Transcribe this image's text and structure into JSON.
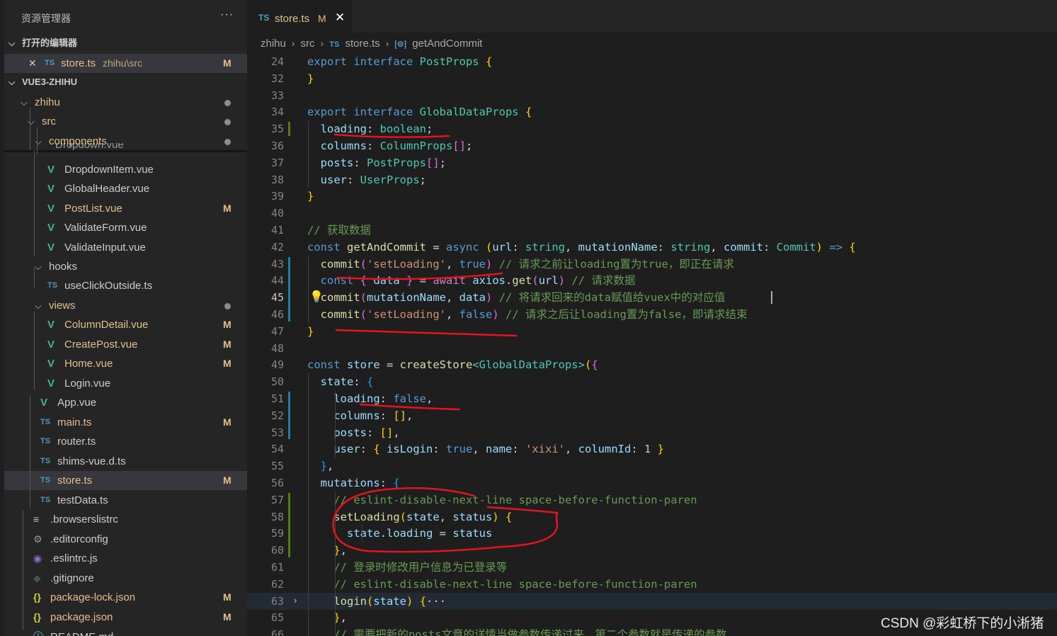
{
  "explorer": {
    "title": "资源管理器",
    "more": "···",
    "open_editors": {
      "label": "打开的编辑器",
      "items": [
        {
          "icon": "TS",
          "name": "store.ts",
          "path": "zhihu\\src",
          "badge": "M"
        }
      ]
    },
    "project": {
      "label": "VUE3-ZHIHU"
    },
    "partial_item": "Dropdown.vue",
    "tree": [
      {
        "name": "zhihu",
        "type": "folder",
        "dot": true
      },
      {
        "name": "src",
        "type": "folder",
        "dot": true
      },
      {
        "name": "components",
        "type": "folder",
        "dot": true
      },
      {
        "name": "DropdownItem.vue",
        "type": "vue",
        "badge": ""
      },
      {
        "name": "GlobalHeader.vue",
        "type": "vue",
        "badge": ""
      },
      {
        "name": "PostList.vue",
        "type": "vue",
        "badge": "M"
      },
      {
        "name": "ValidateForm.vue",
        "type": "vue",
        "badge": ""
      },
      {
        "name": "ValidateInput.vue",
        "type": "vue",
        "badge": ""
      },
      {
        "name": "hooks",
        "type": "folder",
        "dot": false
      },
      {
        "name": "useClickOutside.ts",
        "type": "ts",
        "badge": ""
      },
      {
        "name": "views",
        "type": "folder",
        "dot": true
      },
      {
        "name": "ColumnDetail.vue",
        "type": "vue",
        "badge": "M"
      },
      {
        "name": "CreatePost.vue",
        "type": "vue",
        "badge": "M"
      },
      {
        "name": "Home.vue",
        "type": "vue",
        "badge": "M"
      },
      {
        "name": "Login.vue",
        "type": "vue",
        "badge": ""
      },
      {
        "name": "App.vue",
        "type": "vue",
        "badge": ""
      },
      {
        "name": "main.ts",
        "type": "ts",
        "badge": "M"
      },
      {
        "name": "router.ts",
        "type": "ts",
        "badge": ""
      },
      {
        "name": "shims-vue.d.ts",
        "type": "ts",
        "badge": ""
      },
      {
        "name": "store.ts",
        "type": "ts",
        "badge": "M"
      },
      {
        "name": "testData.ts",
        "type": "ts",
        "badge": ""
      },
      {
        "name": ".browserslistrc",
        "type": "lines",
        "badge": ""
      },
      {
        "name": ".editorconfig",
        "type": "gear",
        "badge": ""
      },
      {
        "name": ".eslintrc.js",
        "type": "eslint",
        "badge": ""
      },
      {
        "name": ".gitignore",
        "type": "diamond",
        "badge": ""
      },
      {
        "name": "package-lock.json",
        "type": "json",
        "badge": "M"
      },
      {
        "name": "package.json",
        "type": "json",
        "badge": "M"
      },
      {
        "name": "README.md",
        "type": "info",
        "badge": ""
      }
    ]
  },
  "editor": {
    "tab": {
      "icon": "TS",
      "name": "store.ts",
      "badge": "M",
      "close": "✕"
    },
    "breadcrumb": [
      "zhihu",
      "src",
      "store.ts",
      "getAndCommit"
    ],
    "active_line": "45",
    "lines": [
      {
        "n": "24",
        "t": [
          [
            "kw",
            "export "
          ],
          [
            "kw",
            "interface "
          ],
          [
            "ty",
            "PostProps "
          ],
          [
            "br1",
            "{"
          ]
        ]
      },
      {
        "n": "32",
        "t": [
          [
            "br1",
            "}"
          ]
        ]
      },
      {
        "n": "33",
        "t": []
      },
      {
        "n": "34",
        "t": [
          [
            "kw",
            "export "
          ],
          [
            "kw",
            "interface "
          ],
          [
            "ty",
            "GlobalDataProps "
          ],
          [
            "br1",
            "{"
          ]
        ]
      },
      {
        "n": "35",
        "t": [
          [
            "pu",
            "  "
          ],
          [
            "var",
            "loading"
          ],
          [
            "pu",
            ": "
          ],
          [
            "ty",
            "boolean"
          ],
          [
            "pu",
            ";"
          ]
        ]
      },
      {
        "n": "36",
        "t": [
          [
            "pu",
            "  "
          ],
          [
            "var",
            "columns"
          ],
          [
            "pu",
            ": "
          ],
          [
            "ty",
            "ColumnProps"
          ],
          [
            "br2",
            "[]"
          ],
          [
            "pu",
            ";"
          ]
        ]
      },
      {
        "n": "37",
        "t": [
          [
            "pu",
            "  "
          ],
          [
            "var",
            "posts"
          ],
          [
            "pu",
            ": "
          ],
          [
            "ty",
            "PostProps"
          ],
          [
            "br2",
            "[]"
          ],
          [
            "pu",
            ";"
          ]
        ]
      },
      {
        "n": "38",
        "t": [
          [
            "pu",
            "  "
          ],
          [
            "var",
            "user"
          ],
          [
            "pu",
            ": "
          ],
          [
            "ty",
            "UserProps"
          ],
          [
            "pu",
            ";"
          ]
        ]
      },
      {
        "n": "39",
        "t": [
          [
            "br1",
            "}"
          ]
        ]
      },
      {
        "n": "40",
        "t": []
      },
      {
        "n": "41",
        "t": [
          [
            "cm",
            "// 获取数据"
          ]
        ]
      },
      {
        "n": "42",
        "t": [
          [
            "kw",
            "const "
          ],
          [
            "fn",
            "getAndCommit"
          ],
          [
            "pu",
            " = "
          ],
          [
            "kw",
            "async "
          ],
          [
            "br1",
            "("
          ],
          [
            "var",
            "url"
          ],
          [
            "pu",
            ": "
          ],
          [
            "ty",
            "string"
          ],
          [
            "pu",
            ", "
          ],
          [
            "var",
            "mutationName"
          ],
          [
            "pu",
            ": "
          ],
          [
            "ty",
            "string"
          ],
          [
            "pu",
            ", "
          ],
          [
            "var",
            "commit"
          ],
          [
            "pu",
            ": "
          ],
          [
            "ty",
            "Commit"
          ],
          [
            "br1",
            ")"
          ],
          [
            "pu",
            " "
          ],
          [
            "kw",
            "=>"
          ],
          [
            "pu",
            " "
          ],
          [
            "br1",
            "{"
          ]
        ]
      },
      {
        "n": "43",
        "t": [
          [
            "pu",
            "  "
          ],
          [
            "fn",
            "commit"
          ],
          [
            "br2",
            "("
          ],
          [
            "str",
            "'setLoading'"
          ],
          [
            "pu",
            ", "
          ],
          [
            "kw",
            "true"
          ],
          [
            "br2",
            ")"
          ],
          [
            "pu",
            " "
          ],
          [
            "cm",
            "// 请求之前让loading置为true，即正在请求"
          ]
        ]
      },
      {
        "n": "44",
        "t": [
          [
            "pu",
            "  "
          ],
          [
            "kw",
            "const "
          ],
          [
            "br2",
            "{ "
          ],
          [
            "var",
            "data"
          ],
          [
            "br2",
            " }"
          ],
          [
            "pu",
            " = "
          ],
          [
            "kc",
            "await "
          ],
          [
            "var",
            "axios"
          ],
          [
            "pu",
            "."
          ],
          [
            "fn",
            "get"
          ],
          [
            "br2",
            "("
          ],
          [
            "var",
            "url"
          ],
          [
            "br2",
            ")"
          ],
          [
            "pu",
            " "
          ],
          [
            "cm",
            "// 请求数据"
          ]
        ]
      },
      {
        "n": "45",
        "t": [
          [
            "pu",
            "  "
          ],
          [
            "fn",
            "commit"
          ],
          [
            "br2",
            "("
          ],
          [
            "var",
            "mutationName"
          ],
          [
            "pu",
            ", "
          ],
          [
            "var",
            "data"
          ],
          [
            "br2",
            ")"
          ],
          [
            "pu",
            " "
          ],
          [
            "cm",
            "// 将请求回来的data赋值给vuex中的对应值"
          ]
        ]
      },
      {
        "n": "46",
        "t": [
          [
            "pu",
            "  "
          ],
          [
            "fn",
            "commit"
          ],
          [
            "br2",
            "("
          ],
          [
            "str",
            "'setLoading'"
          ],
          [
            "pu",
            ", "
          ],
          [
            "kw",
            "false"
          ],
          [
            "br2",
            ")"
          ],
          [
            "pu",
            " "
          ],
          [
            "cm",
            "// 请求之后让loading置为false，即请求结束"
          ]
        ]
      },
      {
        "n": "47",
        "t": [
          [
            "br1",
            "}"
          ]
        ]
      },
      {
        "n": "48",
        "t": []
      },
      {
        "n": "49",
        "t": [
          [
            "kw",
            "const "
          ],
          [
            "var",
            "store"
          ],
          [
            "pu",
            " = "
          ],
          [
            "fn",
            "createStore"
          ],
          [
            "ty",
            "<GlobalDataProps>"
          ],
          [
            "br1",
            "("
          ],
          [
            "br2",
            "{"
          ]
        ]
      },
      {
        "n": "50",
        "t": [
          [
            "pu",
            "  "
          ],
          [
            "var",
            "state"
          ],
          [
            "pu",
            ": "
          ],
          [
            "br3",
            "{"
          ]
        ]
      },
      {
        "n": "51",
        "t": [
          [
            "pu",
            "    "
          ],
          [
            "var",
            "loading"
          ],
          [
            "pu",
            ": "
          ],
          [
            "kw",
            "false"
          ],
          [
            "pu",
            ","
          ]
        ]
      },
      {
        "n": "52",
        "t": [
          [
            "pu",
            "    "
          ],
          [
            "var",
            "columns"
          ],
          [
            "pu",
            ": "
          ],
          [
            "br1",
            "[]"
          ],
          [
            "pu",
            ","
          ]
        ]
      },
      {
        "n": "53",
        "t": [
          [
            "pu",
            "    "
          ],
          [
            "var",
            "posts"
          ],
          [
            "pu",
            ": "
          ],
          [
            "br1",
            "[]"
          ],
          [
            "pu",
            ","
          ]
        ]
      },
      {
        "n": "54",
        "t": [
          [
            "pu",
            "    "
          ],
          [
            "var",
            "user"
          ],
          [
            "pu",
            ": "
          ],
          [
            "br1",
            "{ "
          ],
          [
            "var",
            "isLogin"
          ],
          [
            "pu",
            ": "
          ],
          [
            "kw",
            "true"
          ],
          [
            "pu",
            ", "
          ],
          [
            "var",
            "name"
          ],
          [
            "pu",
            ": "
          ],
          [
            "str",
            "'xixi'"
          ],
          [
            "pu",
            ", "
          ],
          [
            "var",
            "columnId"
          ],
          [
            "pu",
            ": "
          ],
          [
            "num",
            "1"
          ],
          [
            "br1",
            " }"
          ]
        ]
      },
      {
        "n": "55",
        "t": [
          [
            "pu",
            "  "
          ],
          [
            "br3",
            "}"
          ],
          [
            "pu",
            ","
          ]
        ]
      },
      {
        "n": "56",
        "t": [
          [
            "pu",
            "  "
          ],
          [
            "var",
            "mutations"
          ],
          [
            "pu",
            ": "
          ],
          [
            "br3",
            "{"
          ]
        ]
      },
      {
        "n": "57",
        "t": [
          [
            "pu",
            "    "
          ],
          [
            "cm",
            "// eslint-disable-next-line space-before-function-paren"
          ]
        ]
      },
      {
        "n": "58",
        "t": [
          [
            "pu",
            "    "
          ],
          [
            "fn",
            "setLoading"
          ],
          [
            "br1",
            "("
          ],
          [
            "var",
            "state"
          ],
          [
            "pu",
            ", "
          ],
          [
            "var",
            "status"
          ],
          [
            "br1",
            ")"
          ],
          [
            "pu",
            " "
          ],
          [
            "br1",
            "{"
          ]
        ]
      },
      {
        "n": "59",
        "t": [
          [
            "pu",
            "      "
          ],
          [
            "var",
            "state"
          ],
          [
            "pu",
            "."
          ],
          [
            "var",
            "loading"
          ],
          [
            "pu",
            " = "
          ],
          [
            "var",
            "status"
          ]
        ]
      },
      {
        "n": "60",
        "t": [
          [
            "pu",
            "    "
          ],
          [
            "br1",
            "}"
          ],
          [
            "pu",
            ","
          ]
        ]
      },
      {
        "n": "61",
        "t": [
          [
            "pu",
            "    "
          ],
          [
            "cm",
            "// 登录时修改用户信息为已登录等"
          ]
        ]
      },
      {
        "n": "62",
        "t": [
          [
            "pu",
            "    "
          ],
          [
            "cm",
            "// eslint-disable-next-line space-before-function-paren"
          ]
        ]
      },
      {
        "n": "63",
        "t": [
          [
            "pu",
            "    "
          ],
          [
            "fn",
            "login"
          ],
          [
            "br1",
            "("
          ],
          [
            "var",
            "state"
          ],
          [
            "br1",
            ")"
          ],
          [
            "pu",
            " "
          ],
          [
            "br1",
            "{"
          ],
          [
            "pu",
            "···"
          ]
        ]
      },
      {
        "n": "65",
        "t": [
          [
            "pu",
            "    "
          ],
          [
            "br1",
            "}"
          ],
          [
            "pu",
            ","
          ]
        ]
      },
      {
        "n": "66",
        "t": [
          [
            "pu",
            "    "
          ],
          [
            "cm",
            "// 需要把新的posts文章的详情当做参数传递过来，第二个参数就是传递的参数"
          ]
        ]
      }
    ]
  },
  "watermark": "CSDN @彩虹桥下的小淅猪",
  "colors": {
    "accent_modified": "#e2c08d",
    "ts_icon": "#519aba",
    "vue_icon": "#41b883",
    "annotation_red": "#e81123"
  }
}
